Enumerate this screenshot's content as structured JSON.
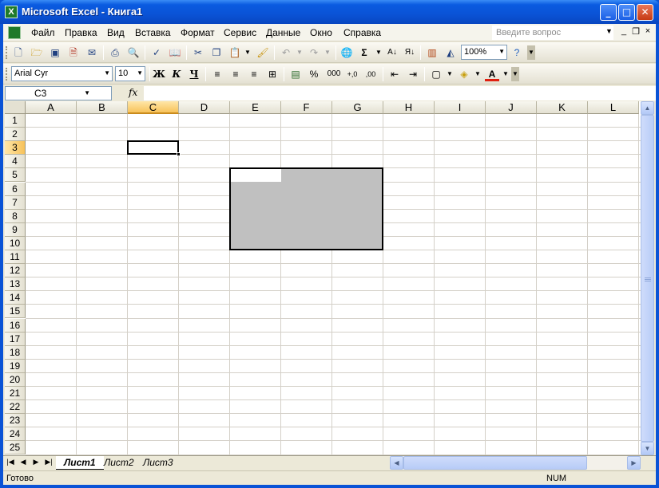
{
  "window": {
    "title": "Microsoft Excel - Книга1",
    "app_icon": "X",
    "controls": {
      "minimize": "_",
      "maximize": "□",
      "close": "✕"
    }
  },
  "menu": {
    "items": [
      "Файл",
      "Правка",
      "Вид",
      "Вставка",
      "Формат",
      "Сервис",
      "Данные",
      "Окно",
      "Справка"
    ],
    "help_placeholder": "Введите вопрос",
    "mdi": {
      "minimize": "_",
      "restore": "❐",
      "close": "×"
    }
  },
  "toolbar_standard": {
    "zoom": "100%",
    "icons": [
      "new-icon",
      "open-icon",
      "save-icon",
      "permission-icon",
      "email-icon",
      "print-icon",
      "print-preview-icon",
      "spelling-icon",
      "research-icon",
      "cut-icon",
      "copy-icon",
      "paste-icon",
      "format-painter-icon",
      "undo-icon",
      "redo-icon",
      "hyperlink-icon",
      "autosum-icon",
      "sort-asc-icon",
      "sort-desc-icon",
      "chart-wizard-icon",
      "drawing-icon",
      "help-icon"
    ]
  },
  "toolbar_formatting": {
    "font": "Arial Cyr",
    "size": "10",
    "bold": "Ж",
    "italic": "К",
    "underline": "Ч",
    "percent": "%",
    "thousands": "000"
  },
  "formula_bar": {
    "name_box": "C3",
    "fx": "fx",
    "content": ""
  },
  "grid": {
    "columns": [
      "A",
      "B",
      "C",
      "D",
      "E",
      "F",
      "G",
      "H",
      "I",
      "J",
      "K",
      "L"
    ],
    "rows": [
      "1",
      "2",
      "3",
      "4",
      "5",
      "6",
      "7",
      "8",
      "9",
      "10",
      "11",
      "12",
      "13",
      "14",
      "15",
      "16",
      "17",
      "18",
      "19",
      "20",
      "21",
      "22",
      "23",
      "24",
      "25"
    ],
    "active_cell": "C3",
    "selected_range": "E5:G10"
  },
  "sheets": {
    "tabs": [
      "Лист1",
      "Лист2",
      "Лист3"
    ],
    "active": "Лист1"
  },
  "status": {
    "text": "Готово",
    "num": "NUM"
  },
  "colors": {
    "title_blue": "#0a53d6",
    "active_header": "#f7c25a",
    "range_fill": "#c0c0c0"
  }
}
